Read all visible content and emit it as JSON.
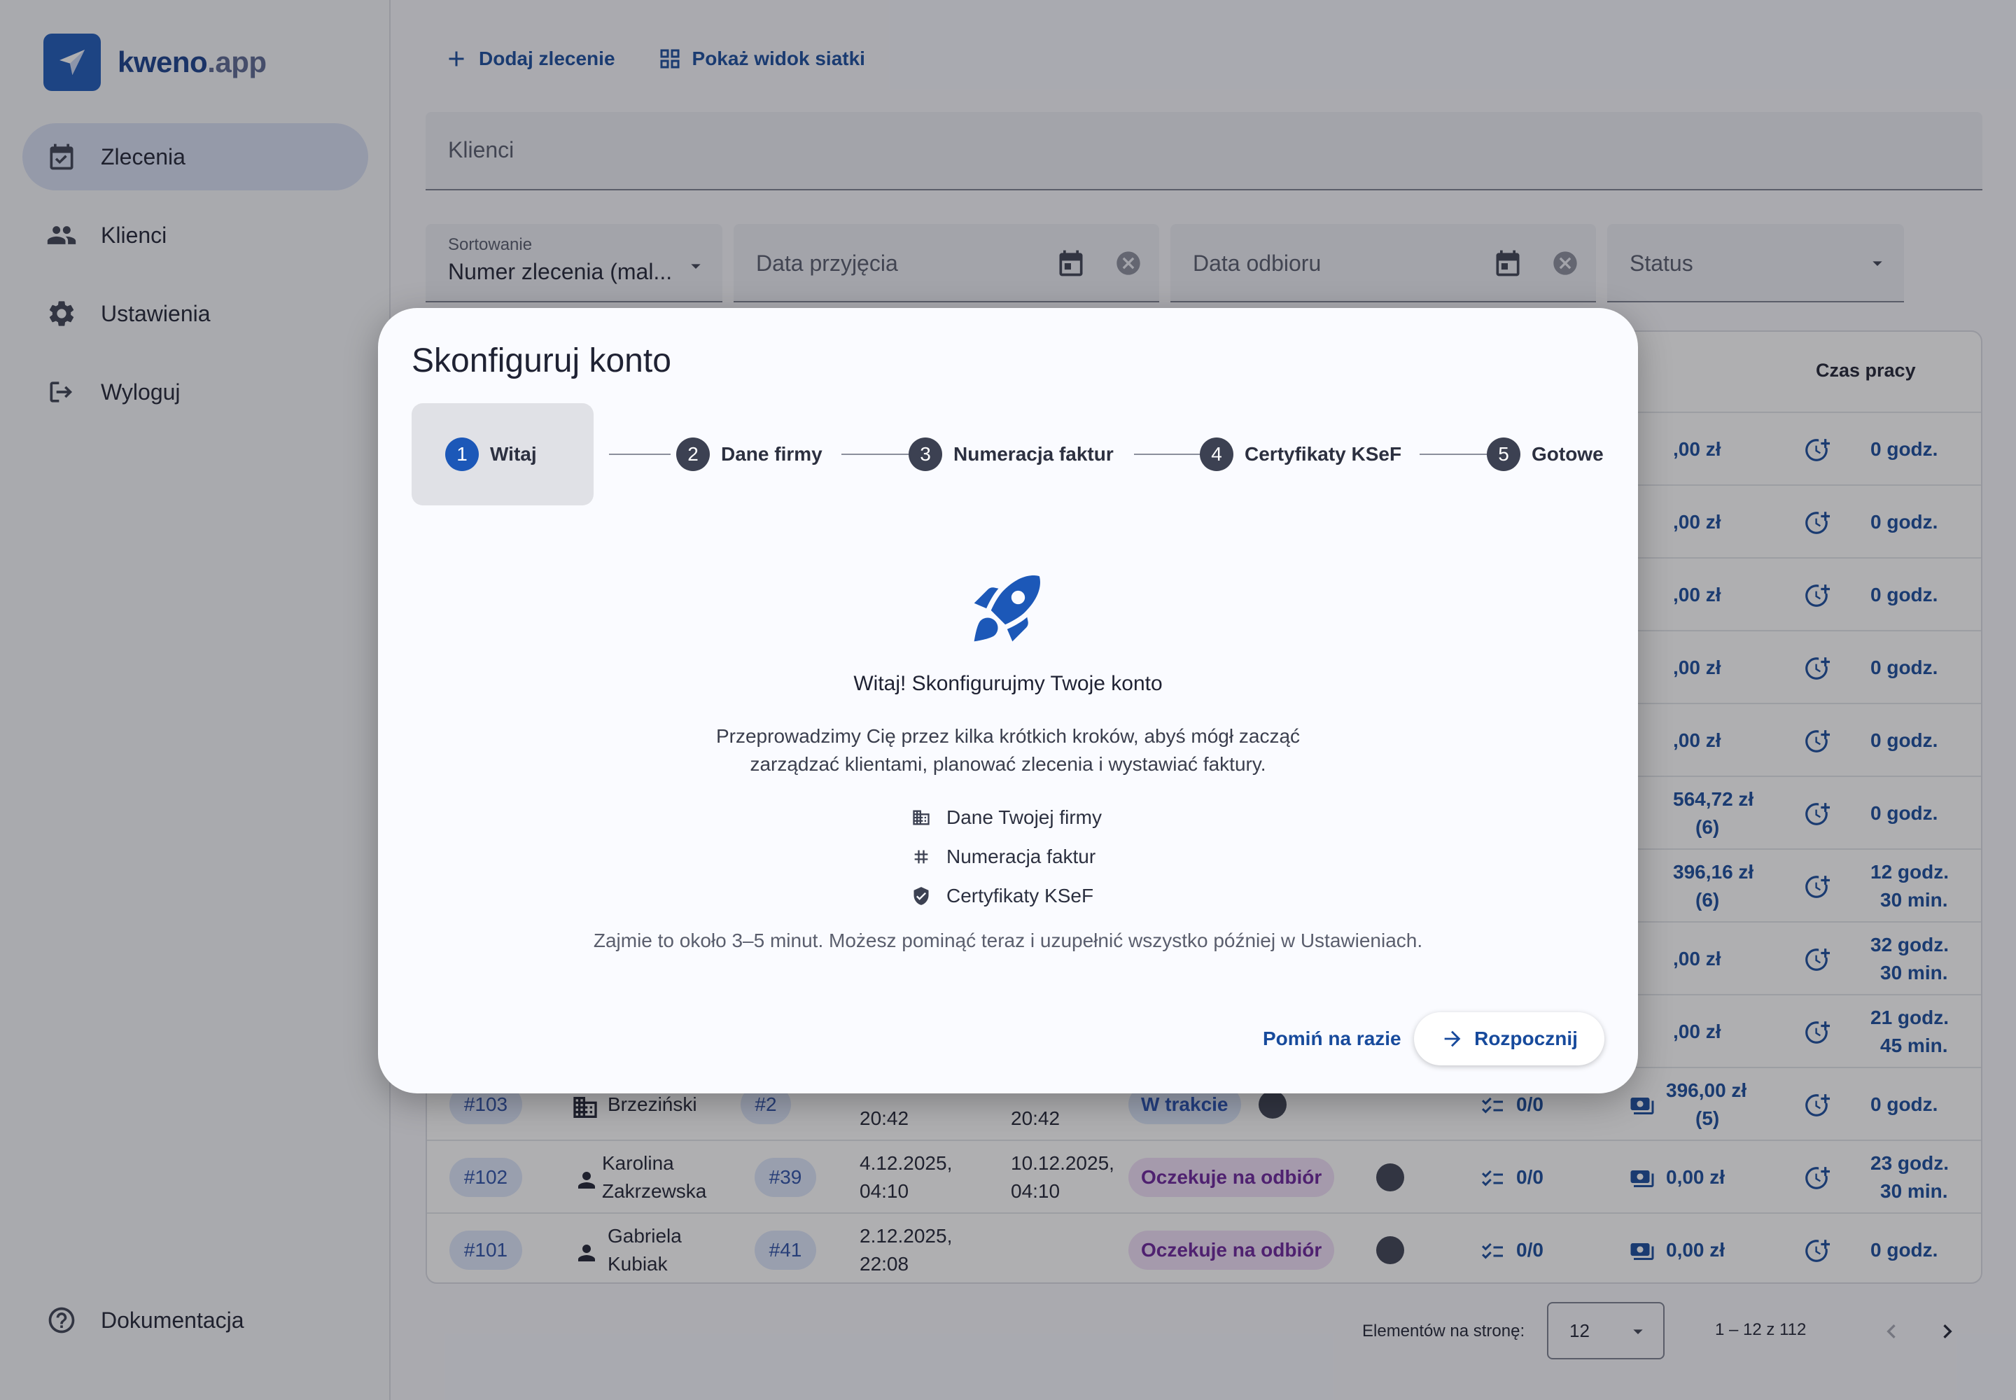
{
  "app": {
    "logo_name": "kweno",
    "logo_suffix": ".app"
  },
  "sidebar": {
    "items": [
      {
        "label": "Zlecenia",
        "icon": "calendar-check-icon",
        "active": true
      },
      {
        "label": "Klienci",
        "icon": "people-icon"
      },
      {
        "label": "Ustawienia",
        "icon": "gear-icon"
      },
      {
        "label": "Wyloguj",
        "icon": "logout-icon"
      }
    ],
    "bottom": {
      "label": "Dokumentacja",
      "icon": "help-circle-icon"
    }
  },
  "toolbar": {
    "add_label": "Dodaj zlecenie",
    "grid_label": "Pokaż widok siatki"
  },
  "filters": {
    "clients_placeholder": "Klienci",
    "sort_label": "Sortowanie",
    "sort_value": "Numer zlecenia (mal...",
    "received_placeholder": "Data przyjęcia",
    "pickup_placeholder": "Data odbioru",
    "status_placeholder": "Status"
  },
  "table": {
    "visible_header": "Czas pracy",
    "amount_fragments": [
      ",00 zł",
      ",00 zł",
      ",00 zł",
      ",00 zł",
      ",00 zł",
      "564,72 zł",
      "396,16 zł",
      ",00 zł",
      ",00 zł"
    ],
    "amount_counts": [
      "",
      "",
      "",
      "",
      "",
      "(6)",
      "(6)",
      "",
      ""
    ],
    "hours_line1": [
      "0 godz.",
      "0 godz.",
      "0 godz.",
      "0 godz.",
      "0 godz.",
      "0 godz.",
      "12 godz.",
      "32 godz.",
      "21 godz."
    ],
    "hours_line2": [
      "",
      "",
      "",
      "",
      "",
      "",
      "30 min.",
      "30 min.",
      "45 min."
    ],
    "rows": [
      {
        "id": "#103",
        "client1": "Brzeziński",
        "client2": "",
        "client_num": "#2",
        "received1": "",
        "received2": "20:42",
        "pickup1": "",
        "pickup2": "20:42",
        "status": "W trakcie",
        "tasks": "0/0",
        "amount": "396,00 zł",
        "amount_count": "(5)",
        "hours1": "0 godz.",
        "hours2": ""
      },
      {
        "id": "#102",
        "client1": "Karolina",
        "client2": "Zakrzewska",
        "client_num": "#39",
        "received1": "4.12.2025,",
        "received2": "04:10",
        "pickup1": "10.12.2025,",
        "pickup2": "04:10",
        "status": "Oczekuje na odbiór",
        "tasks": "0/0",
        "amount": "0,00 zł",
        "amount_count": "",
        "hours1": "23 godz.",
        "hours2": "30 min."
      },
      {
        "id": "#101",
        "client1": "Gabriela",
        "client2": "Kubiak",
        "client_num": "#41",
        "received1": "2.12.2025,",
        "received2": "22:08",
        "pickup1": "",
        "pickup2": "",
        "status": "Oczekuje na odbiór",
        "tasks": "0/0",
        "amount": "0,00 zł",
        "amount_count": "",
        "hours1": "0 godz.",
        "hours2": ""
      }
    ]
  },
  "pagination": {
    "label": "Elementów na stronę:",
    "page_size": "12",
    "range": "1 – 12 z 112"
  },
  "dialog": {
    "title": "Skonfiguruj konto",
    "steps": [
      {
        "num": "1",
        "label": "Witaj",
        "active": true
      },
      {
        "num": "2",
        "label": "Dane firmy"
      },
      {
        "num": "3",
        "label": "Numeracja faktur"
      },
      {
        "num": "4",
        "label": "Certyfikaty KSeF"
      },
      {
        "num": "5",
        "label": "Gotowe"
      }
    ],
    "icon": "rocket-icon",
    "welcome": "Witaj! Skonfigurujmy Twoje konto",
    "intro_line1": "Przeprowadzimy Cię przez kilka krótkich kroków, abyś mógł zacząć",
    "intro_line2": "zarządzać klientami, planować zlecenia i wystawiać faktury.",
    "checklist": [
      {
        "label": "Dane Twojej firmy",
        "icon": "building-icon"
      },
      {
        "label": "Numeracja faktur",
        "icon": "hash-icon"
      },
      {
        "label": "Certyfikaty KSeF",
        "icon": "shield-check-icon"
      }
    ],
    "note": "Zajmie to około 3–5 minut. Możesz pominąć teraz i uzupełnić wszystko później w Ustawieniach.",
    "skip_label": "Pomiń na razie",
    "start_label": "Rozpocznij"
  }
}
